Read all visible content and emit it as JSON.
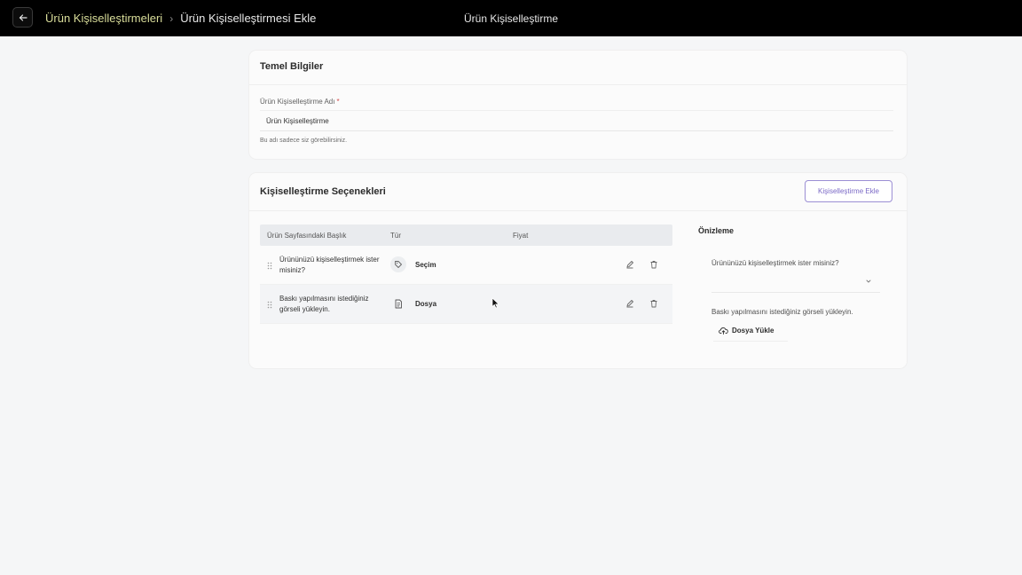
{
  "header": {
    "breadcrumb_parent": "Ürün Kişiselleştirmeleri",
    "breadcrumb_separator": "›",
    "breadcrumb_current": "Ürün Kişiselleştirmesi Ekle",
    "center_title": "Ürün Kişiselleştirme",
    "back_icon": "arrow-left-icon"
  },
  "basic_info": {
    "title": "Temel Bilgiler",
    "name_label": "Ürün Kişiselleştirme Adı",
    "required_mark": "*",
    "name_value": "Ürün Kişiselleştirme",
    "help_text": "Bu adı sadece siz görebilirsiniz."
  },
  "options": {
    "title": "Kişiselleştirme Seçenekleri",
    "add_button_label": "Kişiselleştirme Ekle",
    "columns": {
      "title": "Ürün Sayfasındaki Başlık",
      "type": "Tür",
      "price": "Fiyat"
    },
    "rows": [
      {
        "title": "Ürününüzü kişiselleştirmek ister misiniz?",
        "type": "Seçim",
        "type_icon": "tag-icon"
      },
      {
        "title": "Baskı yapılmasını istediğiniz görseli yükleyin.",
        "type": "Dosya",
        "type_icon": "file-icon"
      }
    ]
  },
  "preview": {
    "title": "Önizleme",
    "question1": "Ürününüzü kişiselleştirmek ister misiniz?",
    "question2": "Baskı yapılmasını istediğiniz görseli yükleyin.",
    "upload_label": "Dosya Yükle"
  },
  "colors": {
    "topbar": "#000000",
    "breadcrumb_link": "#d9dd9a",
    "accent": "#7a68c6",
    "page_bg": "#f5f6f7"
  }
}
